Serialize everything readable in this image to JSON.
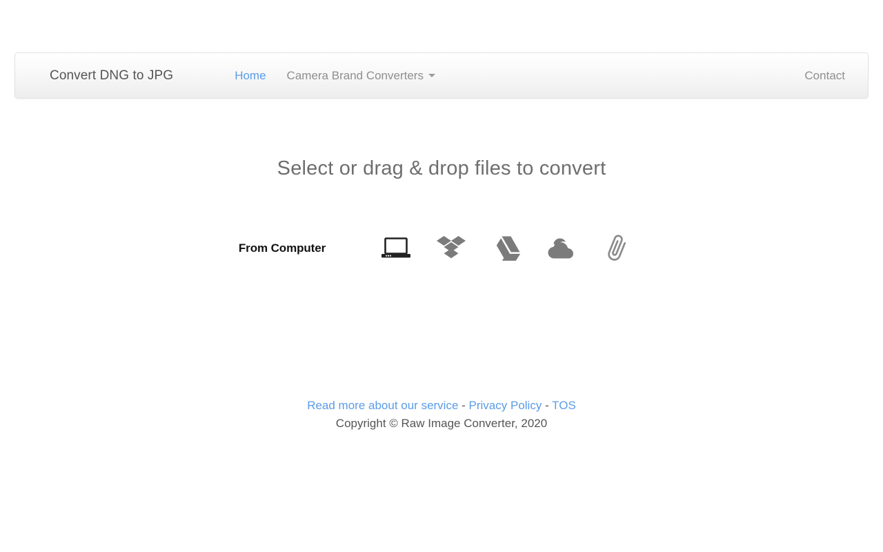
{
  "navbar": {
    "brand": "Convert DNG to JPG",
    "links": [
      {
        "label": "Home",
        "active": true,
        "icon": ""
      },
      {
        "label": "Camera Brand Converters",
        "active": false,
        "icon": "chevron-down-icon"
      }
    ],
    "right_link": {
      "label": "Contact"
    }
  },
  "main": {
    "headline": "Select or drag & drop files to convert",
    "uploader": {
      "label": "From Computer",
      "sources": [
        {
          "name": "laptop-icon",
          "title": "From Computer"
        },
        {
          "name": "dropbox-icon",
          "title": "Dropbox"
        },
        {
          "name": "google-drive-icon",
          "title": "Google Drive"
        },
        {
          "name": "onedrive-cloud-icon",
          "title": "OneDrive"
        },
        {
          "name": "paperclip-icon",
          "title": "Link / Attach"
        }
      ]
    }
  },
  "footer": {
    "link_service": "Read more about our service",
    "sep1": " - ",
    "link_privacy": "Privacy Policy",
    "sep2": " - ",
    "link_tos": "TOS",
    "copyright": "Copyright © Raw Image Converter, 2020"
  },
  "colors": {
    "accent_blue": "#5b9ce8",
    "text_gray": "#555555",
    "muted_gray": "#8f8f8f",
    "heading_gray": "#6e6e6e",
    "icon_gray": "#7b7b7b"
  }
}
